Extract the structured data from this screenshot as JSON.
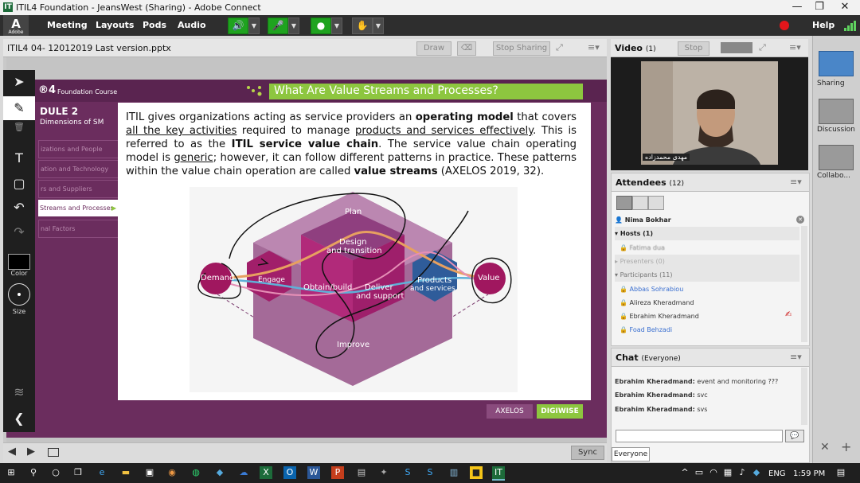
{
  "window": {
    "title": "ITIL4 Foundation - JeansWest (Sharing) - Adobe Connect",
    "minimize": "—",
    "maximize": "❐",
    "close": "✕"
  },
  "menubar": {
    "logo_letter": "A",
    "logo_sub": "Adobe",
    "items": [
      "Meeting",
      "Layouts",
      "Pods",
      "Audio"
    ],
    "help": "Help"
  },
  "share_pod": {
    "file_name": "ITIL4 04- 12012019 Last version.pptx",
    "draw": "Draw",
    "stop_sharing": "Stop Sharing",
    "sync": "Sync"
  },
  "slide": {
    "brand_suffix": "®4",
    "course": "Foundation Course",
    "module_title": "DULE 2",
    "module_subtitle": "Dimensions of SM",
    "heading": "What Are Value Streams and Processes?",
    "nav": [
      "izations and People",
      "ation and Technology",
      "rs and Suppliers",
      "Streams and Processes",
      "nal Factors"
    ],
    "body": [
      {
        "t": "ITIL gives organizations acting as service providers an ",
        "b": false,
        "u": false
      },
      {
        "t": "operating model",
        "b": true,
        "u": false
      },
      {
        "t": " that covers ",
        "b": false,
        "u": false
      },
      {
        "t": "all the key activities",
        "b": false,
        "u": true
      },
      {
        "t": " required to manage ",
        "b": false,
        "u": false
      },
      {
        "t": "products and services effectively",
        "b": false,
        "u": true
      },
      {
        "t": ". This is referred to as the ",
        "b": false,
        "u": false
      },
      {
        "t": "ITIL service value chain",
        "b": true,
        "u": false
      },
      {
        "t": ". The service value chain operating model is ",
        "b": false,
        "u": false
      },
      {
        "t": "generic",
        "b": false,
        "u": true
      },
      {
        "t": "; however, it can follow different patterns in practice. These patterns within the value chain operation are called ",
        "b": false,
        "u": false
      },
      {
        "t": "value streams",
        "b": true,
        "u": false
      },
      {
        "t": " (AXELOS 2019, 32).",
        "b": false,
        "u": false
      }
    ],
    "diagram": {
      "plan": "Plan",
      "design1": "Design",
      "design2": "and transition",
      "engage": "Engage",
      "obtain": "Obtain/build",
      "deliver1": "Deliver",
      "deliver2": "and support",
      "products1": "Products",
      "products2": "and services",
      "improve": "Improve",
      "demand": "Demand",
      "value": "Value"
    },
    "logo_axelos": "AXELOS",
    "logo_digiwise": "DIGIWISE"
  },
  "tools": {
    "color": "Color",
    "size": "Size"
  },
  "video_pod": {
    "title": "Video",
    "count": "(1)",
    "stop": "Stop",
    "name_tag": "مهدی محمدزاده"
  },
  "attendees_pod": {
    "title": "Attendees",
    "count": "(12)",
    "me": "Nima Bokhar",
    "hosts": "Hosts (1)",
    "host_name": "Fatima dua",
    "presenters": "Presenters (0)",
    "participants": "Participants (11)",
    "participant_names": [
      "Abbas Sohrabiou",
      "Alireza Kheradmand",
      "Ebrahim Kheradmand",
      "Foad Behzadi"
    ]
  },
  "chat_pod": {
    "title": "Chat",
    "scope": "(Everyone)",
    "messages": [
      {
        "from": "Ebrahim Kheradmand:",
        "text": "event and monitoring ???"
      },
      {
        "from": "Ebrahim Kheradmand:",
        "text": "svc"
      },
      {
        "from": "Ebrahim Kheradmand:",
        "text": "svs"
      }
    ],
    "input_placeholder": "",
    "recipient": "Everyone"
  },
  "layouts": [
    "Sharing",
    "Discussion",
    "Collabo..."
  ],
  "taskbar": {
    "language": "ENG",
    "time": "1:59 PM"
  }
}
